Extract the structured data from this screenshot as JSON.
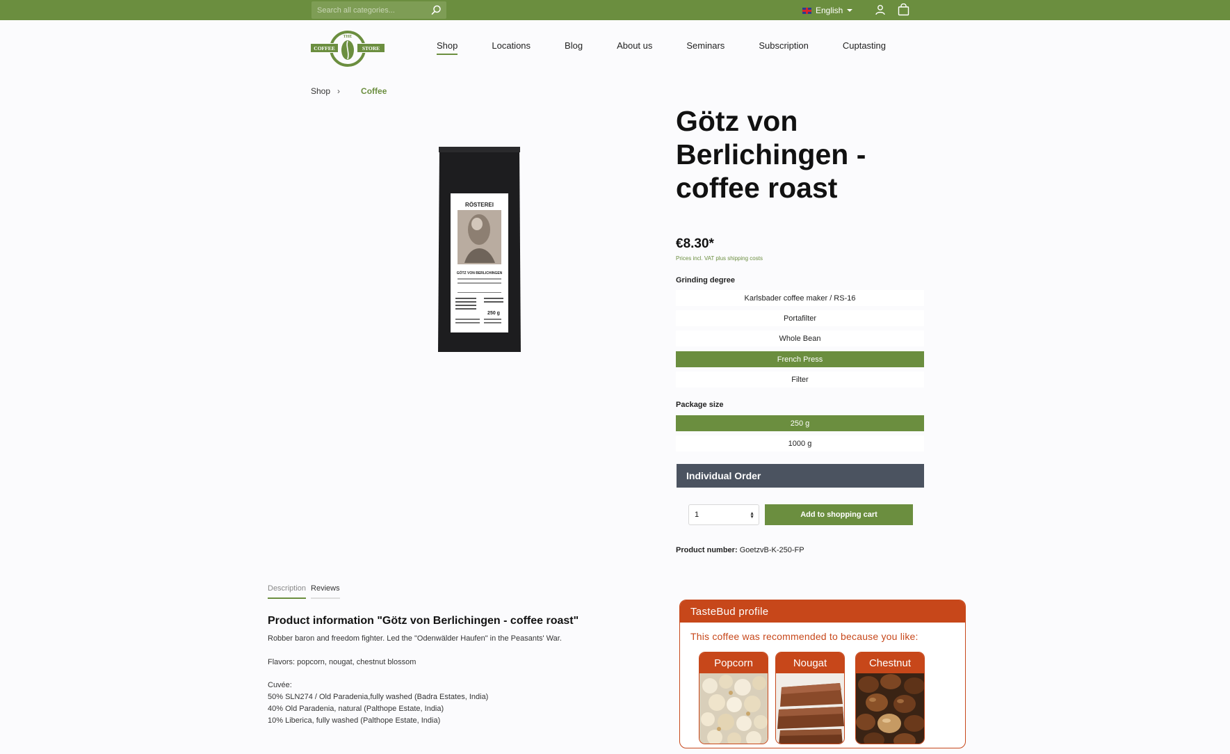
{
  "topbar": {
    "search_placeholder": "Search all categories...",
    "language": "English"
  },
  "logo": {
    "top": "THE",
    "left": "COFFEE",
    "right": "STORE"
  },
  "nav": {
    "items": [
      "Shop",
      "Locations",
      "Blog",
      "About us",
      "Seminars",
      "Subscription",
      "Cuptasting"
    ],
    "active": "Shop"
  },
  "breadcrumb": {
    "items": [
      "Shop",
      "Coffee"
    ]
  },
  "product": {
    "title": "Götz von Berlichingen - coffee roast",
    "price": "€8.30*",
    "price_note": "Prices incl. VAT plus shipping costs",
    "image_labels": {
      "brand": "RÖSTEREI",
      "name": "GÖTZ VON BERLICHINGEN",
      "weight": "250 g"
    },
    "grinding_label": "Grinding degree",
    "grinding_options": [
      "Karlsbader coffee maker / RS-16",
      "Portafilter",
      "Whole Bean",
      "French Press",
      "Filter"
    ],
    "grinding_selected": "French Press",
    "package_label": "Package size",
    "package_options": [
      "250 g",
      "1000 g"
    ],
    "package_selected": "250 g",
    "individual_order": "Individual Order",
    "quantity": "1",
    "add_to_cart": "Add to shopping cart",
    "product_number_label": "Product number:",
    "product_number": "GoetzvB-K-250-FP"
  },
  "tabs": {
    "items": [
      "Description",
      "Reviews"
    ],
    "active": "Description"
  },
  "description": {
    "title": "Product information \"Götz von Berlichingen - coffee roast\"",
    "lines": [
      "Robber baron and freedom fighter. Led the \"Odenwälder Haufen\" in the Peasants' War.",
      "Flavors: popcorn, nougat, chestnut blossom",
      "Cuvée:",
      "50% SLN274 / Old Paradenia,fully washed (Badra Estates, India)",
      "40% Old Paradenia, natural (Palthope Estate, India)",
      "10% Liberica, fully washed (Palthope Estate, India)"
    ]
  },
  "tastebud": {
    "title": "TasteBud profile",
    "subtitle": "This coffee was recommended to because you like:",
    "flavors": [
      "Popcorn",
      "Nougat",
      "Chestnut"
    ]
  },
  "colors": {
    "brand_green": "#6b8e3f",
    "tastebud_orange": "#c7471a",
    "dark_slate": "#4b5360"
  }
}
